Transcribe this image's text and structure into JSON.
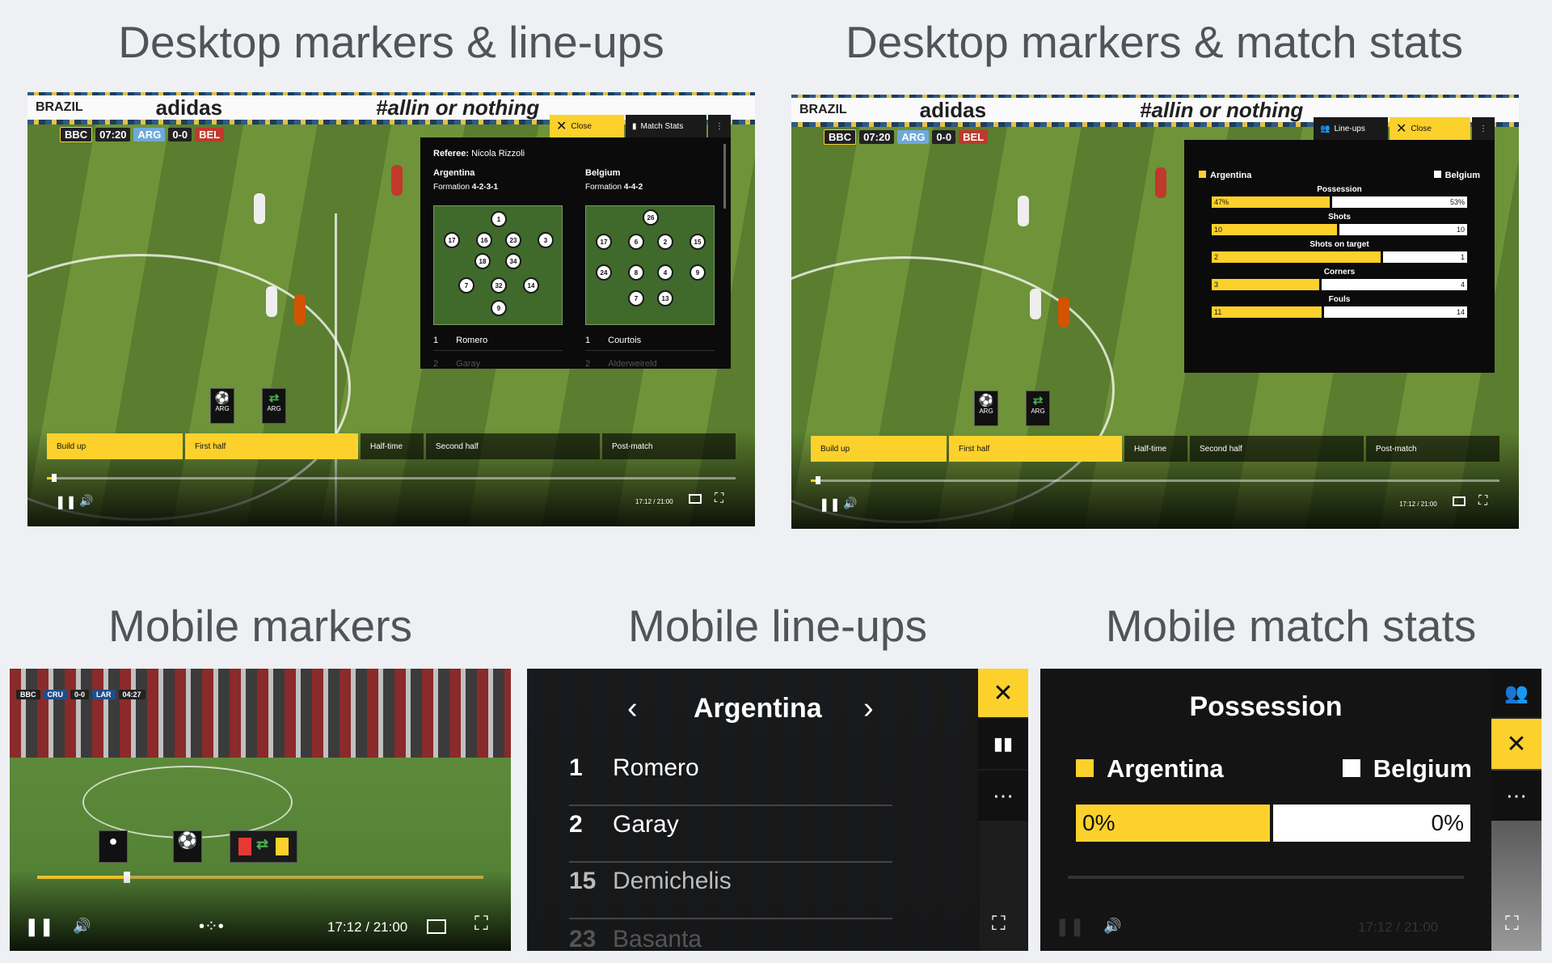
{
  "titles": {
    "desktop_lineups": "Desktop markers & line-ups",
    "desktop_stats": "Desktop markers & match stats",
    "mobile_markers": "Mobile markers",
    "mobile_lineups": "Mobile line-ups",
    "mobile_stats": "Mobile match stats"
  },
  "broadcast": {
    "banner_left": "BRAZIL",
    "banner_brand": "adidas",
    "banner_tag": "#allin or nothing",
    "bbc": "BBC",
    "clock": "07:20",
    "home": "ARG",
    "score": "0-0",
    "away": "BEL"
  },
  "desktop": {
    "close_label": "Close",
    "match_stats_label": "Match Stats",
    "lineups_label": "Line-ups",
    "referee_label": "Referee:",
    "referee": "Nicola Rizzoli",
    "home_team": "Argentina",
    "away_team": "Belgium",
    "formation_label": "Formation",
    "home_formation": "4-2-3-1",
    "away_formation": "4-4-2",
    "home_row1": {
      "num": "1",
      "name": "Romero"
    },
    "away_row1": {
      "num": "1",
      "name": "Courtois"
    },
    "home_row2": {
      "num": "2",
      "name": "Garay"
    },
    "away_row2": {
      "num": "2",
      "name": "Alderweireld"
    },
    "home_numbers": [
      "1",
      "17",
      "16",
      "23",
      "3",
      "18",
      "34",
      "7",
      "32",
      "14",
      "9"
    ],
    "away_numbers": [
      "26",
      "17",
      "6",
      "2",
      "15",
      "24",
      "8",
      "4",
      "9",
      "7",
      "13"
    ],
    "markers": [
      {
        "icon": "ball-icon",
        "glyph": "⚽",
        "team": "ARG"
      },
      {
        "icon": "substitution-icon",
        "glyph": "⇄",
        "team": "ARG"
      }
    ],
    "segments": [
      "Build up",
      "First half",
      "Half-time",
      "Second half",
      "Post-match"
    ],
    "time": "17:12 / 21:00",
    "progress": 0.01,
    "stats": [
      {
        "label": "Possession",
        "home": "47%",
        "away": "53%",
        "home_share": 0.47
      },
      {
        "label": "Shots",
        "home": "10",
        "away": "10",
        "home_share": 0.5
      },
      {
        "label": "Shots on target",
        "home": "2",
        "away": "1",
        "home_share": 0.67
      },
      {
        "label": "Corners",
        "home": "3",
        "away": "4",
        "home_share": 0.43
      },
      {
        "label": "Fouls",
        "home": "11",
        "away": "14",
        "home_share": 0.44
      }
    ]
  },
  "mobile_markers": {
    "bbc": "BBC",
    "home": "CRU",
    "score": "0-0",
    "away": "LAR",
    "clock": "04:27",
    "time": "17:12 / 21:00",
    "progress": 0.2
  },
  "mobile_lineups": {
    "team": "Argentina",
    "rows": [
      {
        "num": "1",
        "name": "Romero"
      },
      {
        "num": "2",
        "name": "Garay"
      },
      {
        "num": "15",
        "name": "Demichelis"
      },
      {
        "num": "23",
        "name": "Basanta"
      }
    ]
  },
  "mobile_stats": {
    "title": "Possession",
    "home": "Argentina",
    "away": "Belgium",
    "home_value": "0%",
    "away_value": "0%",
    "home_share": 0.5,
    "time": "17:12 / 21:00"
  },
  "colors": {
    "accent": "#fcd12c"
  }
}
